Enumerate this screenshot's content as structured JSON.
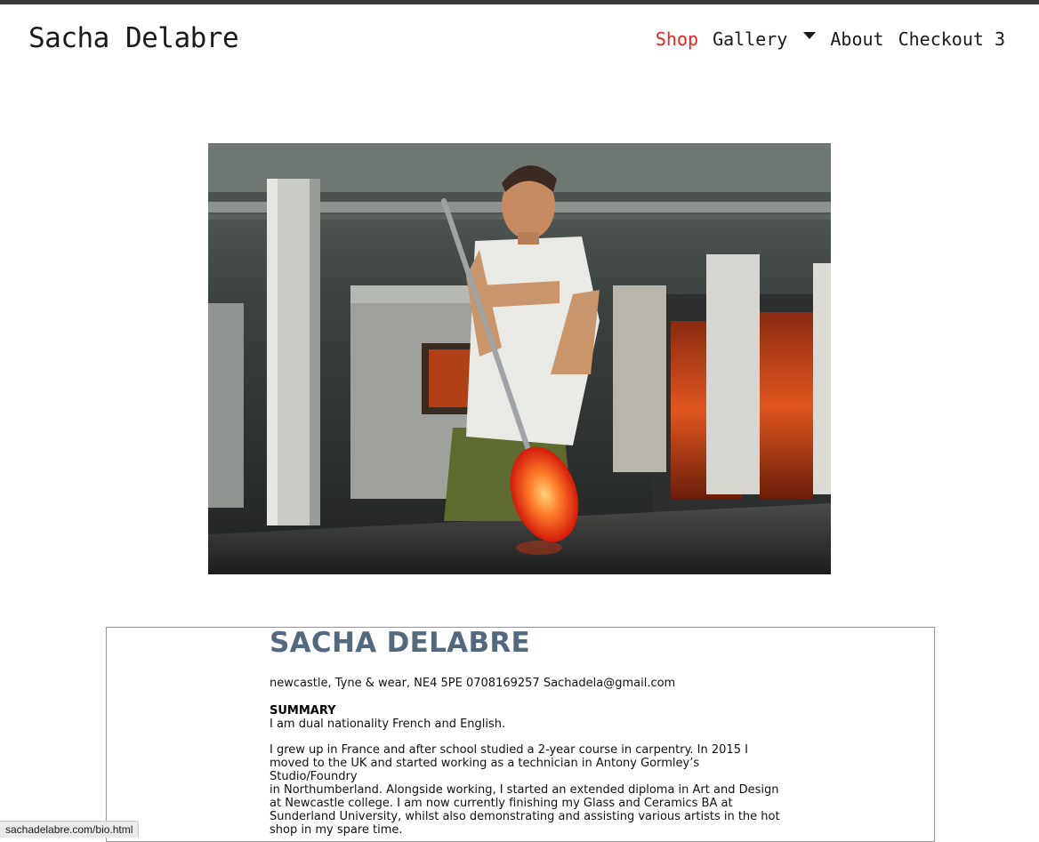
{
  "brand": "Sacha Delabre",
  "nav": {
    "shop": "Shop",
    "gallery": "Gallery",
    "about": "About",
    "checkout": "Checkout 3",
    "active_color": "#e8231b"
  },
  "hero": {
    "image": "glassblower-in-hot-shop-photo"
  },
  "resume": {
    "name": "SACHA DELABRE",
    "contact": "newcastle, Tyne & wear, NE4 5PE 0708169257 Sachadela@gmail.com",
    "summary_heading": "SUMMARY",
    "summary_line1": "I am dual nationality French and English.",
    "summary_lines": [
      "I grew up in France and after school studied a 2-year course in carpentry. In 2015 I",
      "moved to the UK and started working as a technician in Antony Gormley’s Studio/Foundry",
      "in Northumberland. Alongside working, I started an extended diploma in Art and Design",
      "at Newcastle college. I am now currently finishing my Glass and Ceramics BA at",
      "Sunderland University, whilst also demonstrating and assisting various artists in the hot",
      "shop in my spare time."
    ],
    "name_color": "#55697e"
  },
  "status_url": "sachadelabre.com/bio.html"
}
